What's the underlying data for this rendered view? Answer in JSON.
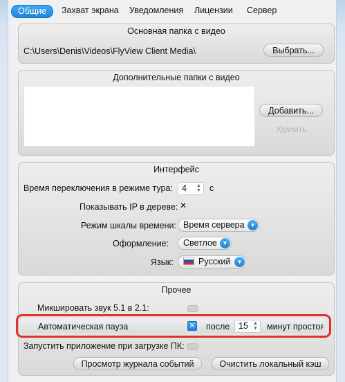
{
  "tabs": [
    "Общие",
    "Захват экрана",
    "Уведомления",
    "Лицензии",
    "Сервер"
  ],
  "main_folder": {
    "title": "Основная папка с видео",
    "path": "C:\\Users\\Denis\\Videos\\FlyView Client Media\\",
    "browse_label": "Выбрать..."
  },
  "extra_folders": {
    "title": "Дополнительные  папки с видео",
    "add_label": "Добавить...",
    "remove_label": "Удалить"
  },
  "interface": {
    "title": "Интерфейс",
    "tour_label": "Время переключения в режиме тура:",
    "tour_value": "4",
    "tour_unit": "с",
    "show_ip_label": "Показывать IP в дереве:",
    "show_ip_check": "✕",
    "timescale_label": "Режим шкалы времени:",
    "timescale_value": "Время сервера",
    "theme_label": "Оформление:",
    "theme_value": "Светлое",
    "language_label": "Язык:",
    "language_value": "Русский"
  },
  "other": {
    "title": "Прочее",
    "mix_label": "Микшировать звук 5.1 в 2.1:",
    "autopause_label": "Автоматическая пауза",
    "autopause_check": "✕",
    "after_label": "после",
    "idle_minutes": "15",
    "idle_label": "минут простоя",
    "autostart_label": "Запустить приложение при загрузке ПК:",
    "event_log_label": "Просмотр журнала событий",
    "clear_cache_label": "Очистить локальный кэш"
  },
  "colors": {
    "accent": "#1f86dc",
    "highlight": "#e0302a"
  }
}
